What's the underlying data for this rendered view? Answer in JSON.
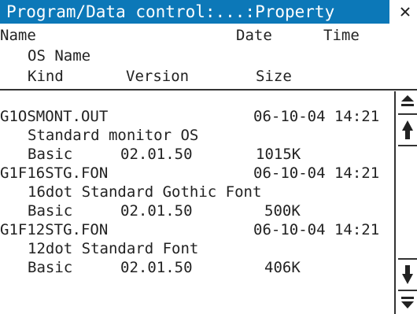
{
  "window": {
    "title": "Program/Data control:...:Property",
    "close_glyph": "✕"
  },
  "columns": {
    "name": "Name",
    "date": "Date",
    "time": "Time",
    "os_name": "OS Name",
    "kind": "Kind",
    "version": "Version",
    "size": "Size"
  },
  "files": [
    {
      "name": "G1OSMONT.OUT",
      "datetime": "06-10-04 14:21",
      "os_name": "Standard monitor OS",
      "kind": "Basic",
      "version": "02.01.50",
      "size": "1015K"
    },
    {
      "name": "G1F16STG.FON",
      "datetime": "06-10-04 14:21",
      "os_name": "16dot Standard Gothic Font",
      "kind": "Basic",
      "version": "02.01.50",
      "size": "500K"
    },
    {
      "name": "G1F12STG.FON",
      "datetime": "06-10-04 14:21",
      "os_name": "12dot Standard Font",
      "kind": "Basic",
      "version": "02.01.50",
      "size": "406K"
    }
  ],
  "scrollbar": {
    "top_icon": "scroll-to-top-icon",
    "up_icon": "scroll-up-icon",
    "down_icon": "scroll-down-icon",
    "bottom_icon": "scroll-to-bottom-icon"
  },
  "colors": {
    "titlebar": "#0c78b8",
    "title_text": "#ffffff",
    "text": "#222222"
  }
}
